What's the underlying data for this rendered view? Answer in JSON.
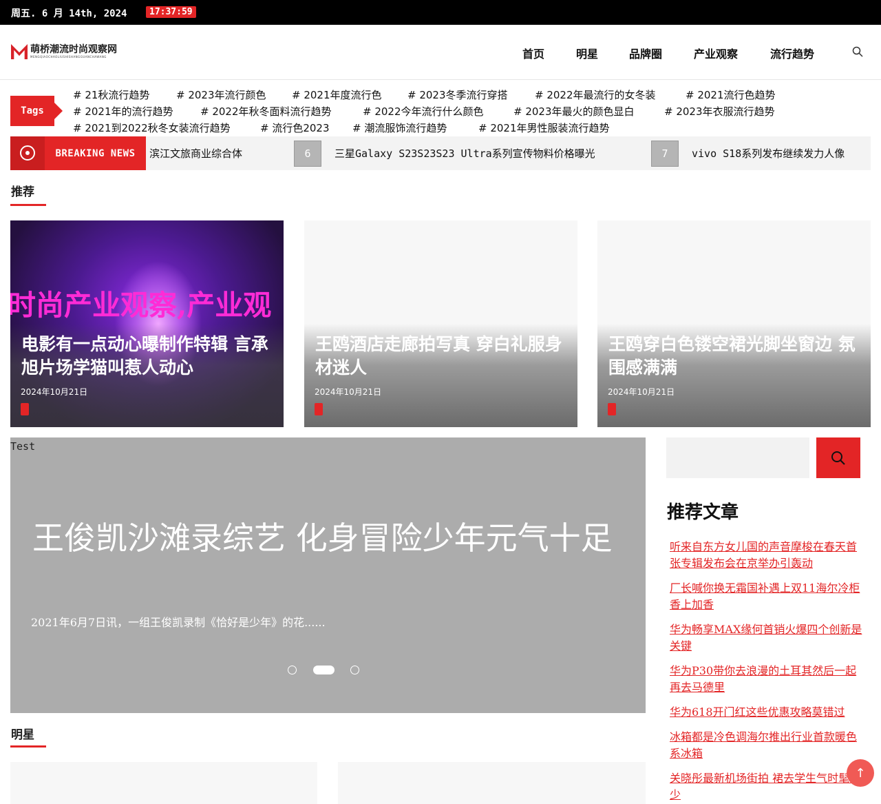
{
  "topbar": {
    "date": "周五. 6 月 14th, 2024",
    "time": "17:37:59"
  },
  "logo": {
    "name": "萌桥潮流时尚观察网",
    "subtitle": "MENGQIAOCHAOLIUSHISHANGGUANCHAWANG"
  },
  "nav": [
    "首页",
    "明星",
    "品牌圈",
    "产业观察",
    "流行趋势"
  ],
  "tags": {
    "label": "Tags",
    "items": [
      "# 21秋流行趋势",
      "# 2023年流行颜色",
      "# 2021年度流行色",
      "# 2023冬季流行穿搭",
      "# 2022年最流行的女冬装",
      "# 2021流行色趋势",
      "# 2021年的流行趋势",
      "# 2022年秋冬面料流行趋势",
      "# 2022今年流行什么颜色",
      "# 2023年最火的颜色显白",
      "# 2023年衣服流行趋势",
      "# 2021到2022秋冬女装流行趋势",
      "# 流行色2023",
      "# 潮流服饰流行趋势",
      "# 2021年男性服装流行趋势"
    ]
  },
  "breaking": {
    "label": "BREAKING NEWS",
    "items": [
      {
        "num": "",
        "text": "滨江文旅商业综合体"
      },
      {
        "num": "6",
        "text": "三星Galaxy S23S23S23 Ultra系列宣传物料价格曝光"
      },
      {
        "num": "7",
        "text": "vivo S18系列发布继续发力人像"
      }
    ]
  },
  "recommend": {
    "heading": "推荐",
    "cards": [
      {
        "overlay": "时尚产业观察,产业观",
        "title": "电影有一点动心曝制作特辑 言承旭片场学猫叫惹人动心",
        "date": "2024年10月21日"
      },
      {
        "title": "王鸥酒店走廊拍写真 穿白礼服身材迷人",
        "date": "2024年10月21日"
      },
      {
        "title": "王鸥穿白色镂空裙光脚坐窗边 氛围感满满",
        "date": "2024年10月21日"
      }
    ]
  },
  "slider": {
    "badge": "Test",
    "title": "王俊凯沙滩录综艺 化身冒险少年元气十足",
    "desc": "2021年6月7日讯，一组王俊凯录制《恰好是少年》的花......",
    "active_index": 1,
    "count": 3
  },
  "sidebar": {
    "search_placeholder": "",
    "title": "推荐文章",
    "links": [
      "听来自东方女儿国的声音摩梭在春天首张专辑发布会在京举办引轰动",
      "厂长喊你换无霜国补遇上双11海尔冷柜香上加香",
      "华为畅享MAX缘何首销火爆四个创新是关键",
      "华为P30带你去浪漫的土耳其然后一起再去马德里",
      "华为618开门红这些优惠攻略莫错过",
      "冰箱都是冷色调海尔推出行业首款暖色系冰箱",
      "关晓彤最新机场街拍 裙去学生气时髦不少"
    ]
  },
  "stars": {
    "heading": "明星"
  },
  "colors": {
    "accent": "#e32526",
    "topbar": "#000000",
    "slider_bg": "#acacac"
  },
  "icons": [
    "search-icon",
    "radio-icon",
    "arrow-up-icon"
  ]
}
